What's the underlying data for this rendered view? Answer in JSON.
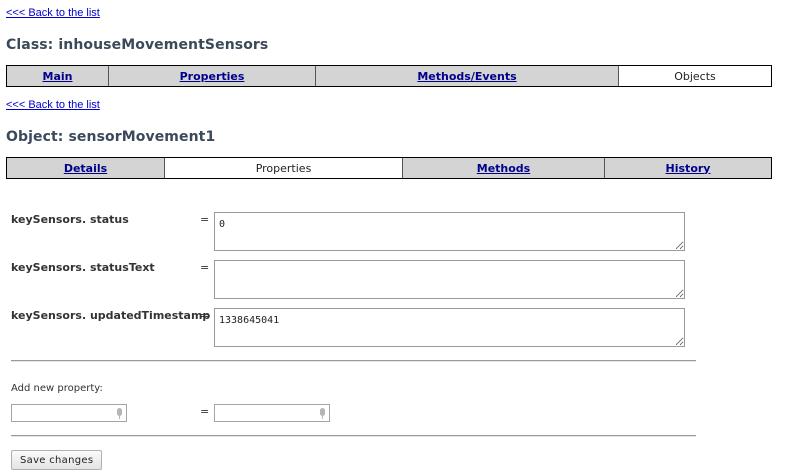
{
  "nav": {
    "back_top": "<<< Back to the list",
    "back_second": "<<< Back to the list"
  },
  "class_title": "Class: inhouseMovementSensors",
  "class_tabs": [
    {
      "label": "Main",
      "active": false
    },
    {
      "label": "Properties",
      "active": false
    },
    {
      "label": "Methods/Events",
      "active": false
    },
    {
      "label": "Objects",
      "active": true
    }
  ],
  "object_title": "Object: sensorMovement1",
  "object_tabs": [
    {
      "label": "Details",
      "active": false
    },
    {
      "label": "Properties",
      "active": true
    },
    {
      "label": "Methods",
      "active": false
    },
    {
      "label": "History",
      "active": false
    }
  ],
  "properties": [
    {
      "name": "keySensors. status",
      "eq": "=",
      "value": "0"
    },
    {
      "name": "keySensors. statusText",
      "eq": "=",
      "value": ""
    },
    {
      "name": "keySensors. updatedTimestamp",
      "eq": "=",
      "value": "1338645041"
    }
  ],
  "add_property": {
    "label": "Add new property:",
    "eq": "=",
    "name_value": "",
    "value_value": ""
  },
  "save_button": "Save changes",
  "icons": {
    "input_mic": "microphone-icon"
  }
}
